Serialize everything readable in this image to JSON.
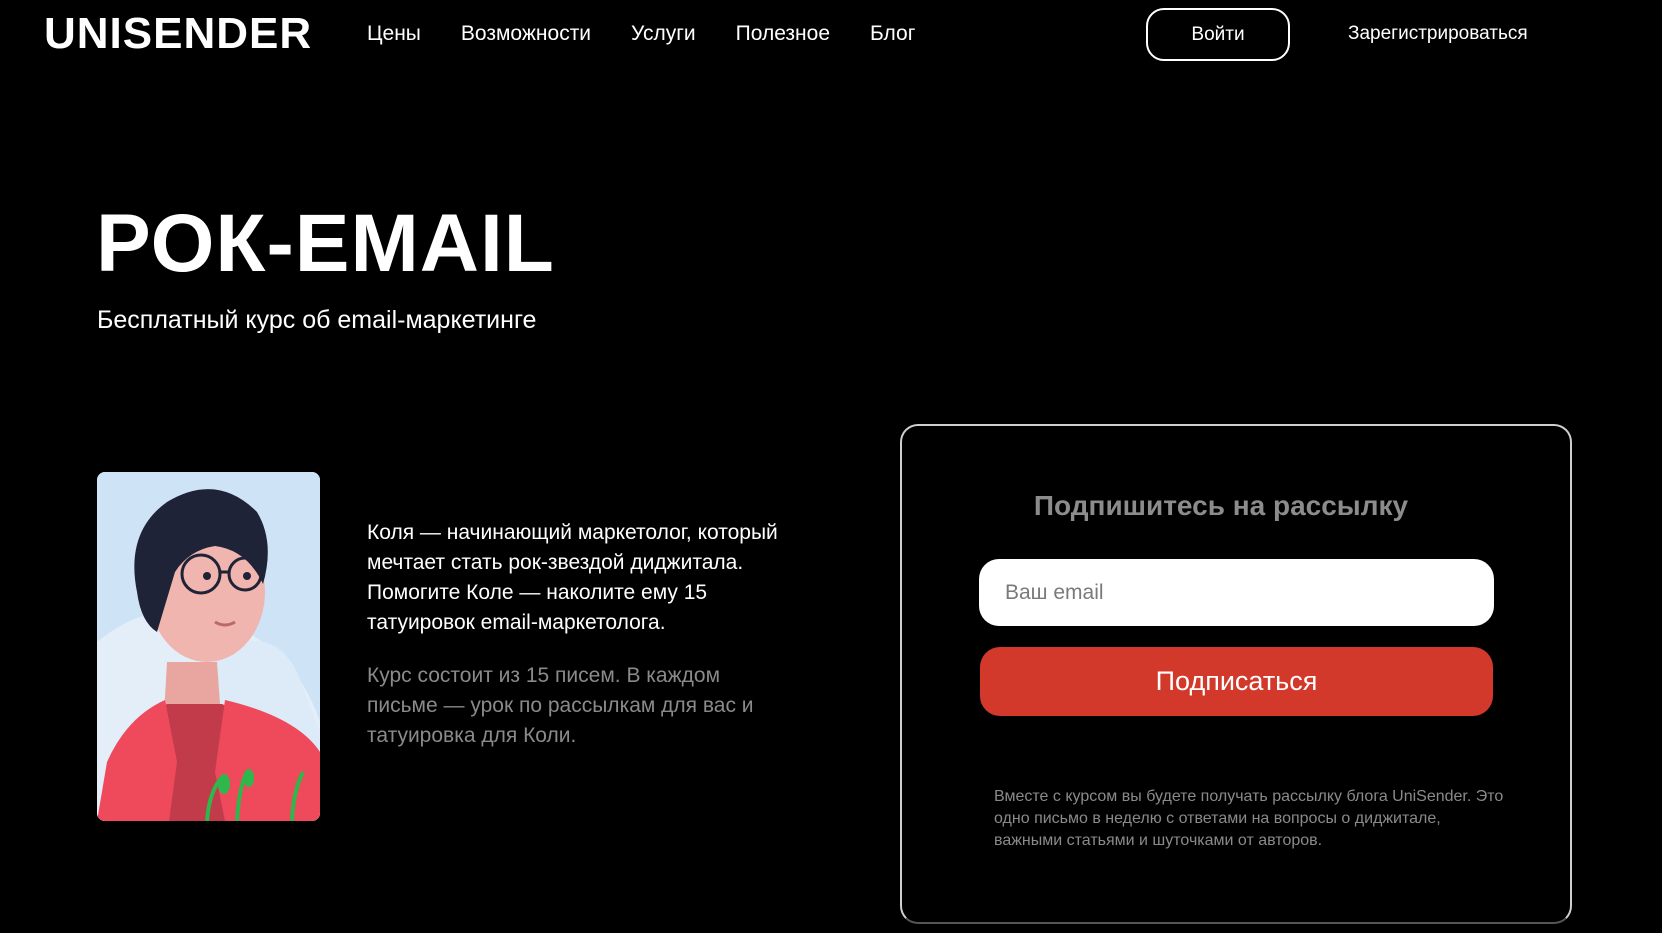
{
  "header": {
    "logo": "UNISENDER",
    "nav": [
      "Цены",
      "Возможности",
      "Услуги",
      "Полезное",
      "Блог"
    ],
    "login_label": "Войти",
    "register_label": "Зарегистрироваться"
  },
  "hero": {
    "title": "РОК-EMAIL",
    "subtitle": "Бесплатный курс об email-маркетинге"
  },
  "intro": {
    "main_text": "Коля — начинающий маркетолог, который мечтает стать рок-звездой диджитала. Помогите Коле — наколите ему 15 татуировок email-маркетолога.",
    "secondary_text": "Курс состоит из 15 писем. В каждом письме — урок по рассылкам для вас и татуировка для Коли."
  },
  "subscribe": {
    "title": "Подпишитесь на рассылку",
    "email_placeholder": "Ваш email",
    "email_value": "",
    "button_label": "Подписаться",
    "note": "Вместе с курсом вы будете получать рассылку блога UniSender. Это одно письмо в неделю с ответами на вопросы о диджитале, важными статьями и шуточками от авторов."
  },
  "colors": {
    "background": "#000000",
    "accent": "#d2392a",
    "muted_text": "#8a8a8a"
  }
}
